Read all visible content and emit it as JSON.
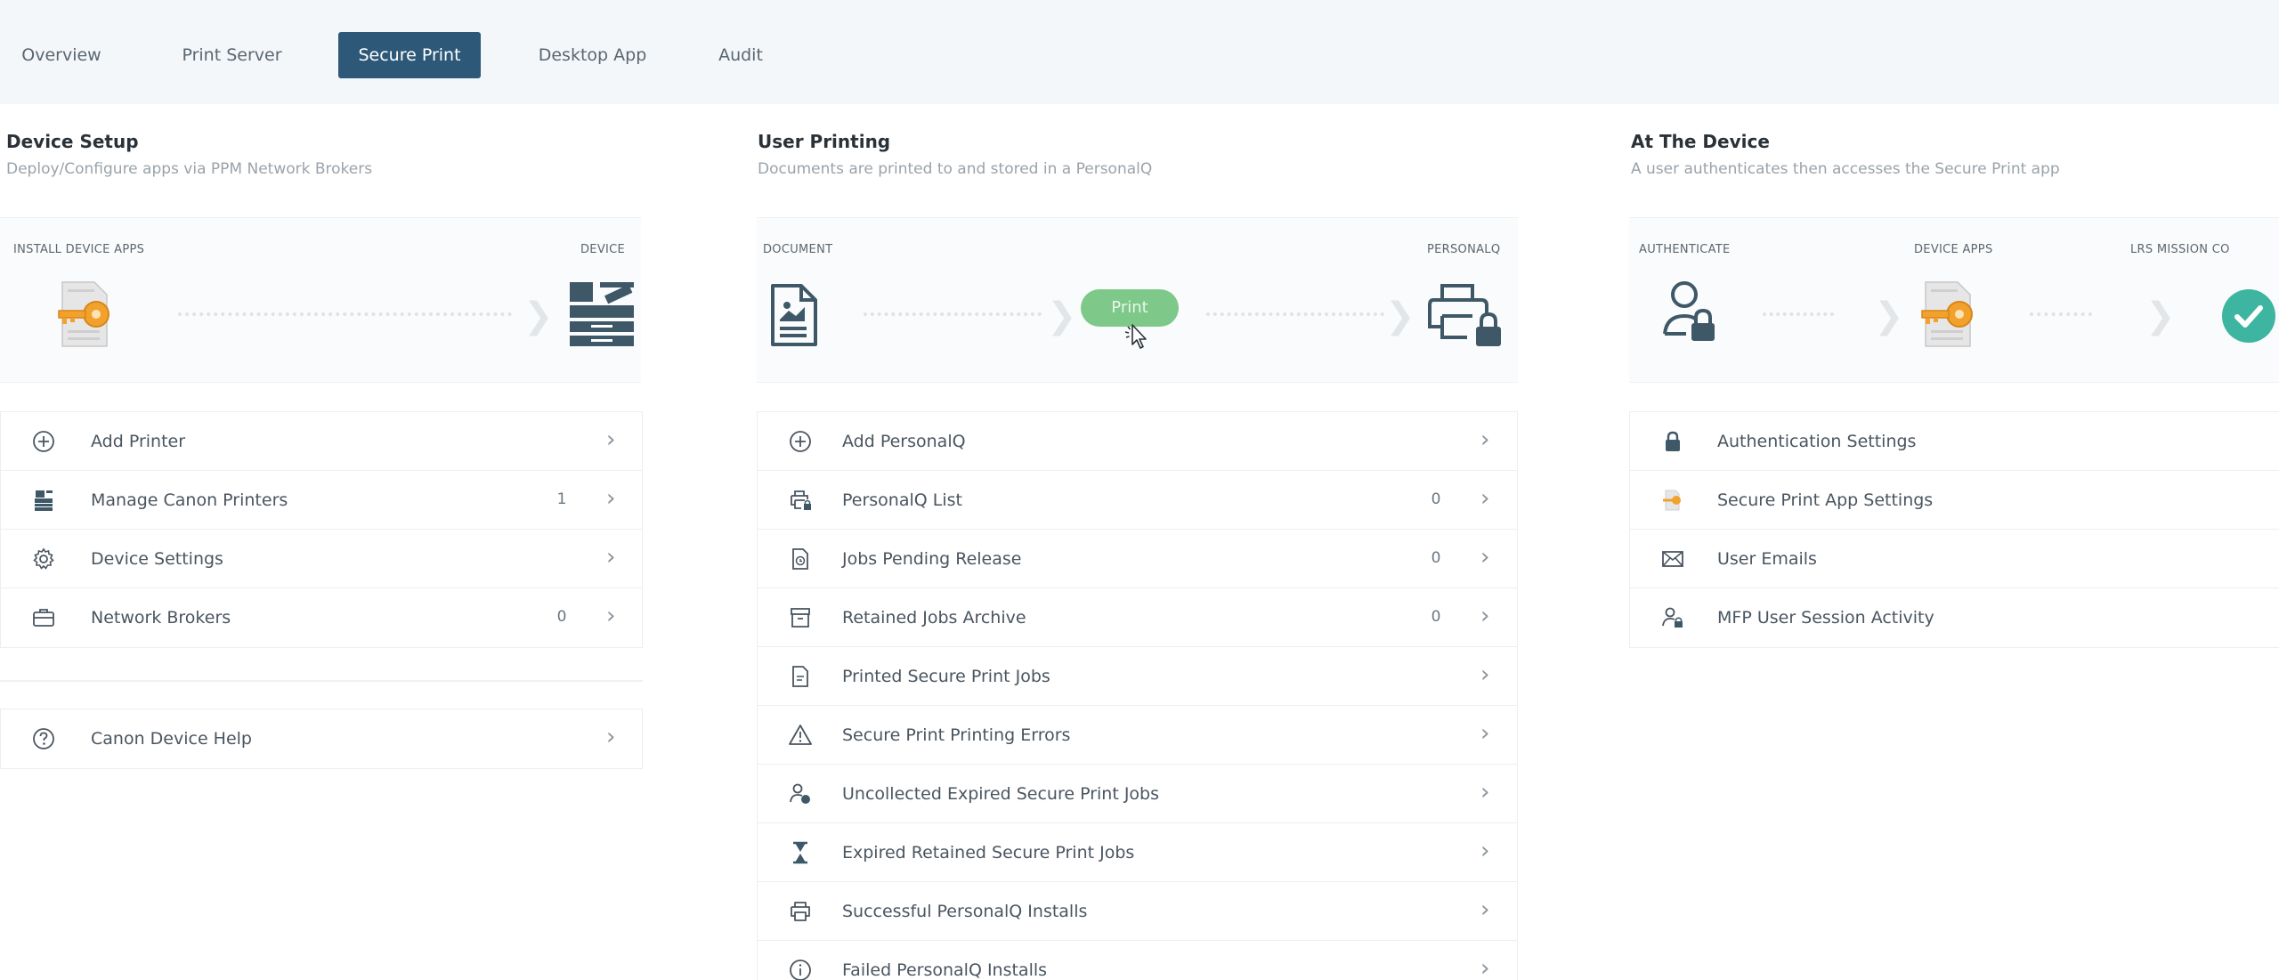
{
  "tabs": [
    {
      "label": "Overview",
      "active": false
    },
    {
      "label": "Print Server",
      "active": false
    },
    {
      "label": "Secure Print",
      "active": true
    },
    {
      "label": "Desktop App",
      "active": false
    },
    {
      "label": "Audit",
      "active": false
    }
  ],
  "device_setup": {
    "title": "Device Setup",
    "subtitle": "Deploy/Configure apps via PPM Network Brokers",
    "flow": {
      "left_label": "INSTALL DEVICE APPS",
      "right_label": "DEVICE"
    },
    "items": [
      {
        "label": "Add Printer",
        "icon": "plus-circle-icon",
        "count": ""
      },
      {
        "label": "Manage Canon Printers",
        "icon": "printer-building-icon",
        "count": "1"
      },
      {
        "label": "Device Settings",
        "icon": "gear-icon",
        "count": ""
      },
      {
        "label": "Network Brokers",
        "icon": "briefcase-icon",
        "count": "0"
      }
    ],
    "help": {
      "label": "Canon Device Help",
      "icon": "question-circle-icon"
    }
  },
  "user_printing": {
    "title": "User Printing",
    "subtitle": "Documents are printed to and stored in a PersonalQ",
    "flow": {
      "left_label": "DOCUMENT",
      "right_label": "PERSONALQ",
      "button": "Print"
    },
    "items": [
      {
        "label": "Add PersonalQ",
        "icon": "plus-circle-icon",
        "count": ""
      },
      {
        "label": "PersonalQ List",
        "icon": "printer-lock-icon",
        "count": "0"
      },
      {
        "label": "Jobs Pending Release",
        "icon": "document-pending-icon",
        "count": "0"
      },
      {
        "label": "Retained Jobs Archive",
        "icon": "archive-icon",
        "count": "0"
      },
      {
        "label": "Printed Secure Print Jobs",
        "icon": "document-icon",
        "count": ""
      },
      {
        "label": "Secure Print Printing Errors",
        "icon": "warning-icon",
        "count": ""
      },
      {
        "label": "Uncollected Expired Secure Print Jobs",
        "icon": "user-clock-icon",
        "count": ""
      },
      {
        "label": "Expired Retained Secure Print Jobs",
        "icon": "hourglass-icon",
        "count": ""
      },
      {
        "label": "Successful PersonalQ Installs",
        "icon": "printer-icon",
        "count": ""
      },
      {
        "label": "Failed PersonalQ Installs",
        "icon": "info-circle-icon",
        "count": ""
      }
    ]
  },
  "at_device": {
    "title": "At The Device",
    "subtitle": "A user authenticates then accesses the Secure Print app",
    "flow": {
      "left_label": "AUTHENTICATE",
      "middle_label": "DEVICE APPS",
      "right_label": "LRS MISSION CO"
    },
    "items": [
      {
        "label": "Authentication Settings",
        "icon": "lock-icon"
      },
      {
        "label": "Secure Print App Settings",
        "icon": "key-app-icon"
      },
      {
        "label": "User Emails",
        "icon": "envelope-icon"
      },
      {
        "label": "MFP User Session Activity",
        "icon": "user-lock-icon"
      }
    ]
  },
  "colors": {
    "accent": "#2d5878",
    "print_button": "#7ec98a",
    "check": "#3db5a0",
    "key": "#f0a030"
  }
}
